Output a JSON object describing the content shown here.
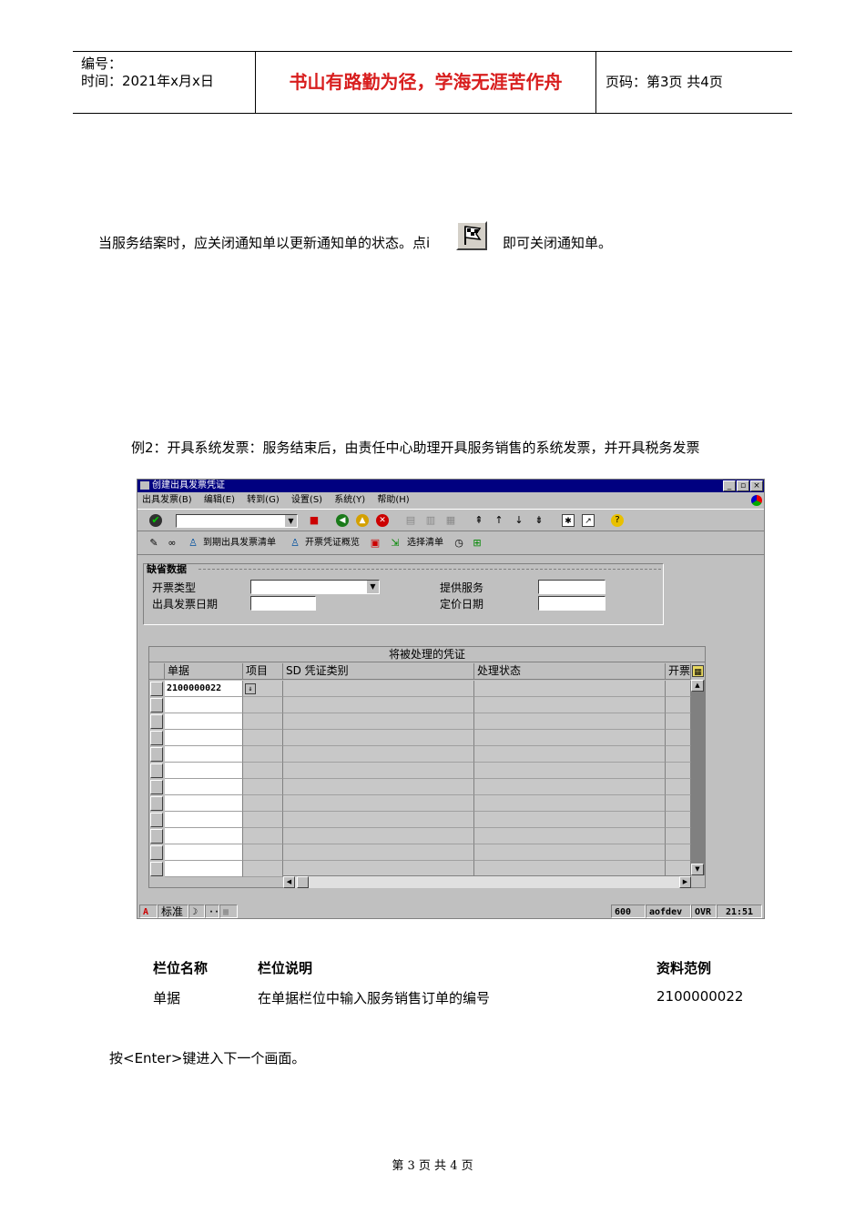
{
  "header": {
    "code_label": "编号：",
    "date_label": "时间：2021年x月x日",
    "motto": "书山有路勤为径，学海无涯苦作舟",
    "page_info": "页码：第3页  共4页"
  },
  "body": {
    "close_text_before": "当服务结案时，应关闭通知单以更新通知单的状态。点i",
    "close_text_after": "即可关闭通知单。",
    "example_heading": "例2：开具系统发票：服务结束后，由责任中心助理开具服务销售的系统发票，并开具税务发票",
    "enter_text": "按<Enter>键进入下一个画面。"
  },
  "sap": {
    "title": "创建出具发票凭证",
    "menu": [
      "出具发票(B)",
      "编辑(E)",
      "转到(G)",
      "设置(S)",
      "系统(Y)",
      "帮助(H)"
    ],
    "toolbar2": {
      "due_list": "到期出具发票清单",
      "doc_overview": "开票凭证概览",
      "select_list": "选择清单"
    },
    "defaults": {
      "title": "缺省数据",
      "billing_type_label": "开票类型",
      "billing_date_label": "出具发票日期",
      "service_label": "提供服务",
      "pricing_date_label": "定价日期"
    },
    "table": {
      "caption": "将被处理的凭证",
      "columns": [
        "单据",
        "项目",
        "SD 凭证类别",
        "处理状态",
        "开票"
      ],
      "first_doc": "2100000022"
    },
    "status": {
      "mode": "标准",
      "client": "600",
      "server": "aofdev",
      "ovr": "OVR",
      "time": "21:51"
    }
  },
  "fields_table": {
    "headers": [
      "栏位名称",
      "栏位说明",
      "资料范例"
    ],
    "row": [
      "单据",
      "在单据栏位中输入服务销售订单的编号",
      "2100000022"
    ]
  },
  "footer": {
    "page": "第 3 页 共 4 页"
  }
}
